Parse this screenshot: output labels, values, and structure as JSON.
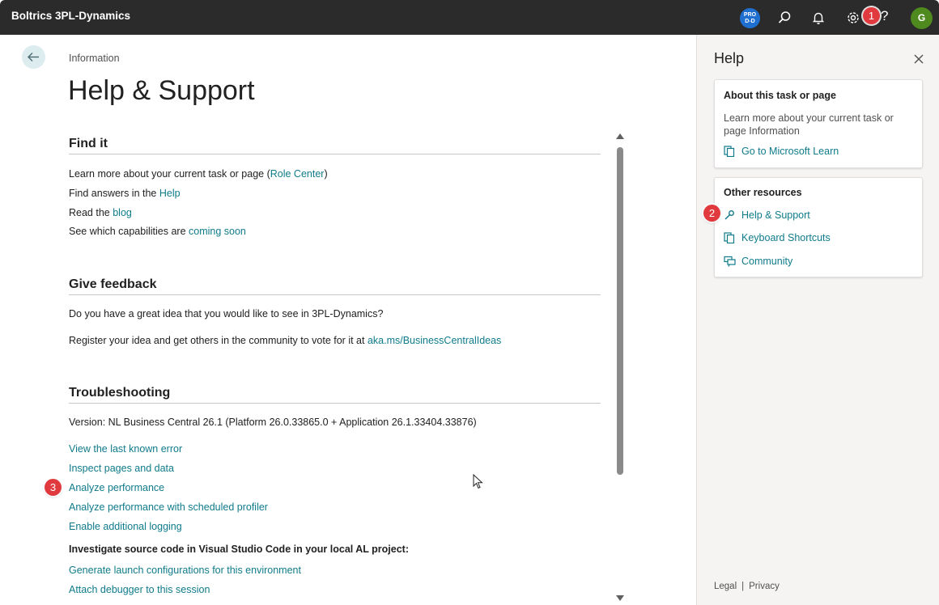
{
  "topbar": {
    "app_title": "Boltrics 3PL-Dynamics",
    "env_badge_line1": "PRO",
    "env_badge_line2": "D-D",
    "help_glyph": "?",
    "avatar_initial": "G",
    "icons": [
      "search-icon",
      "bell-icon",
      "gear-icon",
      "help-icon"
    ]
  },
  "markers": {
    "m1": "1",
    "m2": "2",
    "m3": "3"
  },
  "main": {
    "breadcrumb": "Information",
    "title": "Help & Support",
    "find_it": {
      "heading": "Find it",
      "line1_prefix": "Learn more about your current task or page (",
      "line1_link": "Role Center",
      "line1_suffix": ")",
      "line2_prefix": "Find answers in the ",
      "line2_link": "Help",
      "line3_prefix": "Read the ",
      "line3_link": "blog",
      "line4_prefix": "See which capabilities are ",
      "line4_link": "coming soon"
    },
    "feedback": {
      "heading": "Give feedback",
      "line1": "Do you have a great idea that you would like to see in 3PL-Dynamics?",
      "line2_prefix": "Register your idea and get others in the community to vote for it at ",
      "line2_link": "aka.ms/BusinessCentralIdeas"
    },
    "troubleshooting": {
      "heading": "Troubleshooting",
      "version": "Version: NL Business Central 26.1 (Platform 26.0.33865.0 + Application 26.1.33404.33876)",
      "links": [
        "View the last known error",
        "Inspect pages and data",
        "Analyze performance",
        "Analyze performance with scheduled profiler",
        "Enable additional logging"
      ],
      "vscode_heading": "Investigate source code in Visual Studio Code in your local AL project:",
      "vscode_links": [
        "Generate launch configurations for this environment",
        "Attach debugger to this session"
      ]
    }
  },
  "help_pane": {
    "title": "Help",
    "about": {
      "title": "About this task or page",
      "text": "Learn more about your current task or page Information",
      "link": "Go to Microsoft Learn"
    },
    "resources": {
      "title": "Other resources",
      "items": [
        "Help & Support",
        "Keyboard Shortcuts",
        "Community"
      ]
    },
    "footer": {
      "legal": "Legal",
      "sep": "|",
      "privacy": "Privacy"
    }
  },
  "colors": {
    "topbar": "#2b2b2b",
    "link": "#0f7b8a",
    "marker": "#e03a3e",
    "avatar": "#4f8a1f",
    "env_badge": "#1f6fd1"
  }
}
